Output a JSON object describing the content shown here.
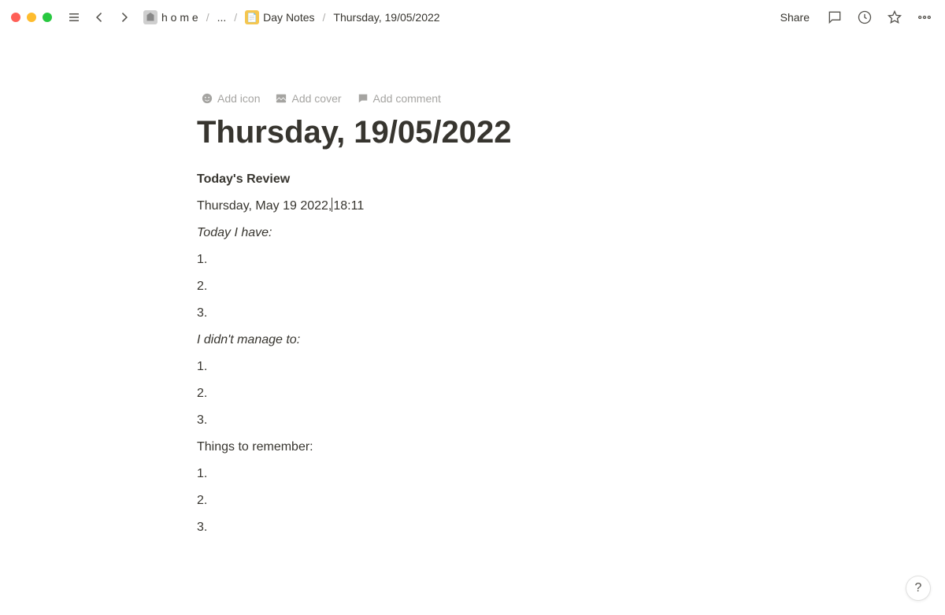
{
  "topbar": {
    "breadcrumb": {
      "home_label": "h o m e",
      "ellipsis": "...",
      "folder_label": "Day Notes",
      "current_label": "Thursday, 19/05/2022"
    },
    "share_label": "Share"
  },
  "page_actions": {
    "add_icon": "Add icon",
    "add_cover": "Add cover",
    "add_comment": "Add comment"
  },
  "page": {
    "title": "Thursday, 19/05/2022",
    "heading": "Today's Review",
    "timestamp_prefix": "Thursday, May 19 2022,",
    "timestamp_time": "18:11",
    "section1_label": "Today I have:",
    "section2_label": "I didn't manage to:",
    "section3_label": "Things to remember:",
    "list_items": [
      "1.",
      "2.",
      "3."
    ]
  },
  "help_label": "?"
}
